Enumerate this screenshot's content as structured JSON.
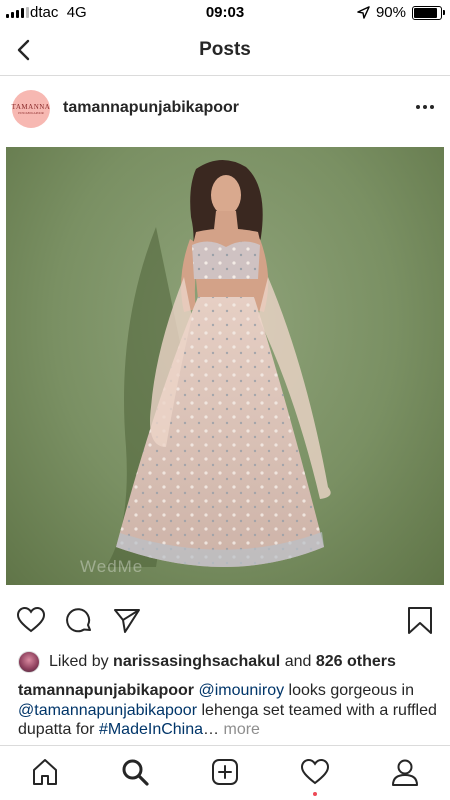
{
  "status_bar": {
    "carrier": "dtac",
    "network": "4G",
    "time": "09:03",
    "battery_percent": "90%",
    "battery_level": 0.9
  },
  "nav": {
    "title": "Posts"
  },
  "post": {
    "avatar_text": "TAMANNA",
    "avatar_subtext": "PUNJABI KAPOOR",
    "username": "tamannapunjabikapoor",
    "watermark": "WedMe",
    "likes": {
      "prefix": "Liked by",
      "liker": "narissasinghsachakul",
      "joiner": "and",
      "others": "826 others"
    },
    "caption": {
      "author": "tamannapunjabikapoor",
      "mention_1": "@imouniroy",
      "text_1": "looks gorgeous in",
      "mention_2": "@tamannapunjabikapoor",
      "text_2": "lehenga set teamed with a ruffled dupatta for",
      "hashtag": "#MadeInChina",
      "ellipsis": "…",
      "more": "more"
    }
  },
  "icons": {
    "back": "chevron-left-icon",
    "more": "more-horizontal-icon",
    "like": "heart-icon",
    "comment": "comment-icon",
    "share": "paper-plane-icon",
    "save": "bookmark-icon",
    "home": "home-icon",
    "search": "search-icon",
    "new_post": "plus-square-icon",
    "activity": "heart-icon",
    "profile": "user-icon"
  },
  "colors": {
    "text": "#262626",
    "mention": "#003569",
    "muted": "#8e8e8e",
    "divider": "#dbdbdb",
    "notification": "#ed4956",
    "avatar_bg": "#f7b8b2"
  }
}
